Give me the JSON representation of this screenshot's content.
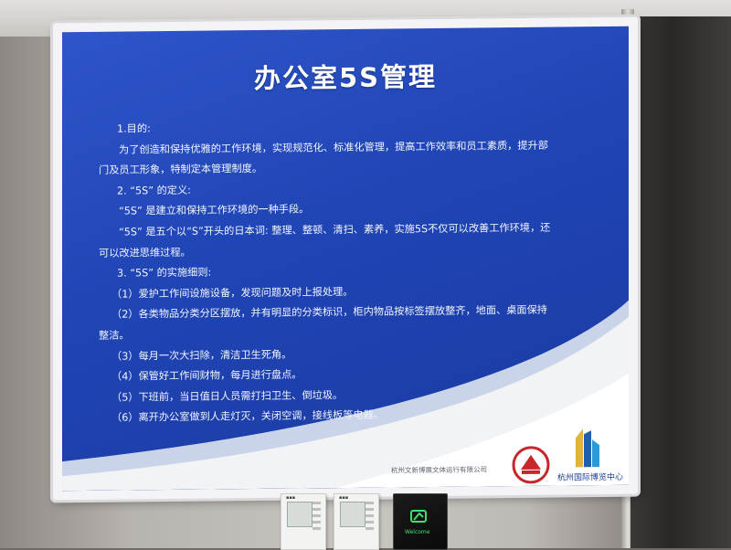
{
  "sign": {
    "title": "办公室5S管理",
    "lines": [
      {
        "kind": "h",
        "text": "1.目的:"
      },
      {
        "kind": "p",
        "text": "为了创造和保持优雅的工作环境，实现规范化、标准化管理，提高工作效率和员工素质，提升部"
      },
      {
        "kind": "c",
        "text": "门及员工形象，特制定本管理制度。"
      },
      {
        "kind": "h",
        "text": "2. “5S” 的定义:"
      },
      {
        "kind": "p",
        "text": "“5S” 是建立和保持工作环境的一种手段。"
      },
      {
        "kind": "p",
        "text": "“5S” 是五个以“S”开头的日本词: 整理、整顿、清扫、素养，实施5S不仅可以改善工作环境，还"
      },
      {
        "kind": "c",
        "text": "可以改进思维过程。"
      },
      {
        "kind": "h",
        "text": "3. “5S” 的实施细则:"
      },
      {
        "kind": "i",
        "text": "（1）爱护工作间设施设备，发现问题及时上报处理。"
      },
      {
        "kind": "i",
        "text": "（2）各类物品分类分区摆放，并有明显的分类标识，柜内物品按标签摆放整齐，地面、桌面保持"
      },
      {
        "kind": "c",
        "text": "整洁。"
      },
      {
        "kind": "i",
        "text": "（3）每月一次大扫除，清洁卫生死角。"
      },
      {
        "kind": "i",
        "text": "（4）保管好工作间财物，每月进行盘点。"
      },
      {
        "kind": "i",
        "text": "（5）下班前，当日值日人员需打扫卫生、倒垃圾。"
      },
      {
        "kind": "i",
        "text": "（6）离开办公室做到人走灯灭，关闭空调，接线板等电器。"
      }
    ],
    "footer_note": "杭州文新博展文体运行有限公司",
    "venue_name": "杭州国际博览中心"
  },
  "wall_panels": {
    "switch_text": "Welcome"
  },
  "colors": {
    "panel_blue": "#2348b8",
    "text": "#f2f4ff",
    "accent_red": "#c8262b"
  }
}
